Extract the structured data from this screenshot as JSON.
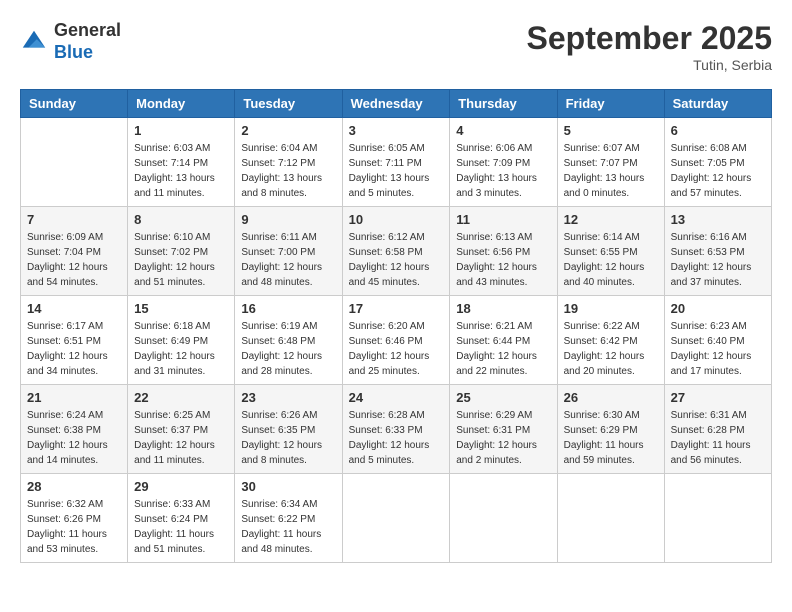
{
  "header": {
    "logo_line1": "General",
    "logo_line2": "Blue",
    "month": "September 2025",
    "location": "Tutin, Serbia"
  },
  "days_of_week": [
    "Sunday",
    "Monday",
    "Tuesday",
    "Wednesday",
    "Thursday",
    "Friday",
    "Saturday"
  ],
  "weeks": [
    [
      {
        "day": "",
        "info": ""
      },
      {
        "day": "1",
        "info": "Sunrise: 6:03 AM\nSunset: 7:14 PM\nDaylight: 13 hours and 11 minutes."
      },
      {
        "day": "2",
        "info": "Sunrise: 6:04 AM\nSunset: 7:12 PM\nDaylight: 13 hours and 8 minutes."
      },
      {
        "day": "3",
        "info": "Sunrise: 6:05 AM\nSunset: 7:11 PM\nDaylight: 13 hours and 5 minutes."
      },
      {
        "day": "4",
        "info": "Sunrise: 6:06 AM\nSunset: 7:09 PM\nDaylight: 13 hours and 3 minutes."
      },
      {
        "day": "5",
        "info": "Sunrise: 6:07 AM\nSunset: 7:07 PM\nDaylight: 13 hours and 0 minutes."
      },
      {
        "day": "6",
        "info": "Sunrise: 6:08 AM\nSunset: 7:05 PM\nDaylight: 12 hours and 57 minutes."
      }
    ],
    [
      {
        "day": "7",
        "info": "Sunrise: 6:09 AM\nSunset: 7:04 PM\nDaylight: 12 hours and 54 minutes."
      },
      {
        "day": "8",
        "info": "Sunrise: 6:10 AM\nSunset: 7:02 PM\nDaylight: 12 hours and 51 minutes."
      },
      {
        "day": "9",
        "info": "Sunrise: 6:11 AM\nSunset: 7:00 PM\nDaylight: 12 hours and 48 minutes."
      },
      {
        "day": "10",
        "info": "Sunrise: 6:12 AM\nSunset: 6:58 PM\nDaylight: 12 hours and 45 minutes."
      },
      {
        "day": "11",
        "info": "Sunrise: 6:13 AM\nSunset: 6:56 PM\nDaylight: 12 hours and 43 minutes."
      },
      {
        "day": "12",
        "info": "Sunrise: 6:14 AM\nSunset: 6:55 PM\nDaylight: 12 hours and 40 minutes."
      },
      {
        "day": "13",
        "info": "Sunrise: 6:16 AM\nSunset: 6:53 PM\nDaylight: 12 hours and 37 minutes."
      }
    ],
    [
      {
        "day": "14",
        "info": "Sunrise: 6:17 AM\nSunset: 6:51 PM\nDaylight: 12 hours and 34 minutes."
      },
      {
        "day": "15",
        "info": "Sunrise: 6:18 AM\nSunset: 6:49 PM\nDaylight: 12 hours and 31 minutes."
      },
      {
        "day": "16",
        "info": "Sunrise: 6:19 AM\nSunset: 6:48 PM\nDaylight: 12 hours and 28 minutes."
      },
      {
        "day": "17",
        "info": "Sunrise: 6:20 AM\nSunset: 6:46 PM\nDaylight: 12 hours and 25 minutes."
      },
      {
        "day": "18",
        "info": "Sunrise: 6:21 AM\nSunset: 6:44 PM\nDaylight: 12 hours and 22 minutes."
      },
      {
        "day": "19",
        "info": "Sunrise: 6:22 AM\nSunset: 6:42 PM\nDaylight: 12 hours and 20 minutes."
      },
      {
        "day": "20",
        "info": "Sunrise: 6:23 AM\nSunset: 6:40 PM\nDaylight: 12 hours and 17 minutes."
      }
    ],
    [
      {
        "day": "21",
        "info": "Sunrise: 6:24 AM\nSunset: 6:38 PM\nDaylight: 12 hours and 14 minutes."
      },
      {
        "day": "22",
        "info": "Sunrise: 6:25 AM\nSunset: 6:37 PM\nDaylight: 12 hours and 11 minutes."
      },
      {
        "day": "23",
        "info": "Sunrise: 6:26 AM\nSunset: 6:35 PM\nDaylight: 12 hours and 8 minutes."
      },
      {
        "day": "24",
        "info": "Sunrise: 6:28 AM\nSunset: 6:33 PM\nDaylight: 12 hours and 5 minutes."
      },
      {
        "day": "25",
        "info": "Sunrise: 6:29 AM\nSunset: 6:31 PM\nDaylight: 12 hours and 2 minutes."
      },
      {
        "day": "26",
        "info": "Sunrise: 6:30 AM\nSunset: 6:29 PM\nDaylight: 11 hours and 59 minutes."
      },
      {
        "day": "27",
        "info": "Sunrise: 6:31 AM\nSunset: 6:28 PM\nDaylight: 11 hours and 56 minutes."
      }
    ],
    [
      {
        "day": "28",
        "info": "Sunrise: 6:32 AM\nSunset: 6:26 PM\nDaylight: 11 hours and 53 minutes."
      },
      {
        "day": "29",
        "info": "Sunrise: 6:33 AM\nSunset: 6:24 PM\nDaylight: 11 hours and 51 minutes."
      },
      {
        "day": "30",
        "info": "Sunrise: 6:34 AM\nSunset: 6:22 PM\nDaylight: 11 hours and 48 minutes."
      },
      {
        "day": "",
        "info": ""
      },
      {
        "day": "",
        "info": ""
      },
      {
        "day": "",
        "info": ""
      },
      {
        "day": "",
        "info": ""
      }
    ]
  ]
}
